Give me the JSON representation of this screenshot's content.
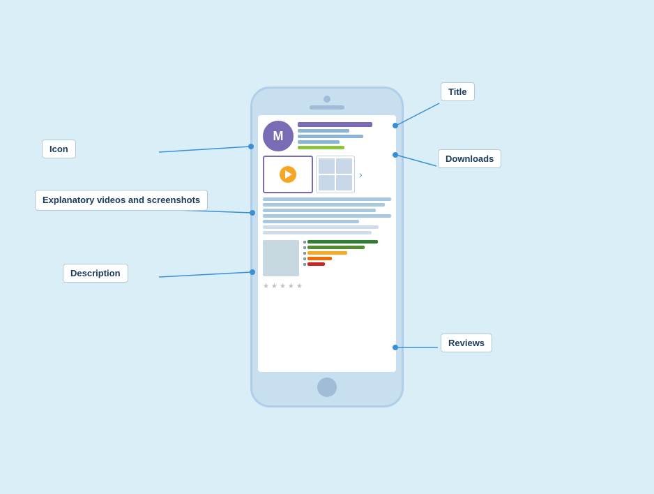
{
  "labels": {
    "title": "Title",
    "icon": "Icon",
    "explanatory": "Explanatory videos and\nscreenshots",
    "description": "Description",
    "downloads": "Downloads",
    "reviews": "Reviews"
  },
  "app": {
    "icon_letter": "M",
    "stars": [
      "★",
      "★",
      "★",
      "★",
      "★"
    ]
  },
  "review_bars": [
    {
      "color": "#2e7d32",
      "width": "80%"
    },
    {
      "color": "#558b2f",
      "width": "65%"
    },
    {
      "color": "#f9a825",
      "width": "45%"
    },
    {
      "color": "#ef6c00",
      "width": "28%"
    },
    {
      "color": "#c62828",
      "width": "20%"
    }
  ]
}
